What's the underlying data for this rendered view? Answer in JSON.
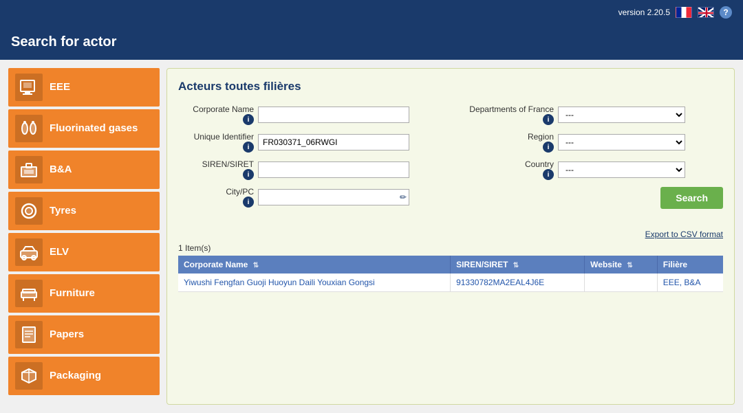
{
  "topbar": {
    "version": "version 2.20.5"
  },
  "header": {
    "title": "Search for actor"
  },
  "sidebar": {
    "items": [
      {
        "id": "eee",
        "label": "EEE",
        "icon": "🖥"
      },
      {
        "id": "fluorinated",
        "label": "Fluorinated gases",
        "icon": "🔧"
      },
      {
        "id": "bna",
        "label": "B&A",
        "icon": "📦"
      },
      {
        "id": "tyres",
        "label": "Tyres",
        "icon": "⭕"
      },
      {
        "id": "elv",
        "label": "ELV",
        "icon": "🚗"
      },
      {
        "id": "furniture",
        "label": "Furniture",
        "icon": "🛋"
      },
      {
        "id": "papers",
        "label": "Papers",
        "icon": "📄"
      },
      {
        "id": "packaging",
        "label": "Packaging",
        "icon": "📦"
      }
    ]
  },
  "content": {
    "title": "Acteurs toutes filières",
    "form": {
      "corporate_name_label": "Corporate Name",
      "corporate_name_value": "",
      "corporate_name_placeholder": "",
      "unique_identifier_label": "Unique Identifier",
      "unique_identifier_value": "FR030371_06RWGI",
      "siren_siret_label": "SIREN/SIRET",
      "siren_siret_value": "",
      "city_pc_label": "City/PC",
      "city_pc_value": "",
      "departments_label": "Departments of France",
      "departments_value": "---",
      "region_label": "Region",
      "region_value": "---",
      "country_label": "Country",
      "country_value": "---",
      "dropdown_options": [
        "---"
      ],
      "search_button": "Search",
      "export_link": "Export to CSV format"
    },
    "results": {
      "count_text": "1 Item(s)",
      "columns": [
        {
          "id": "corp_name",
          "label": "Corporate Name"
        },
        {
          "id": "siren_siret",
          "label": "SIREN/SIRET"
        },
        {
          "id": "website",
          "label": "Website"
        },
        {
          "id": "filiere",
          "label": "Filière"
        }
      ],
      "rows": [
        {
          "corp_name": "Yiwushi Fengfan Guoji Huoyun Daili Youxian Gongsi",
          "siren_siret": "91330782MA2EAL4J6E",
          "website": "",
          "filiere": "EEE, B&A"
        }
      ]
    }
  }
}
